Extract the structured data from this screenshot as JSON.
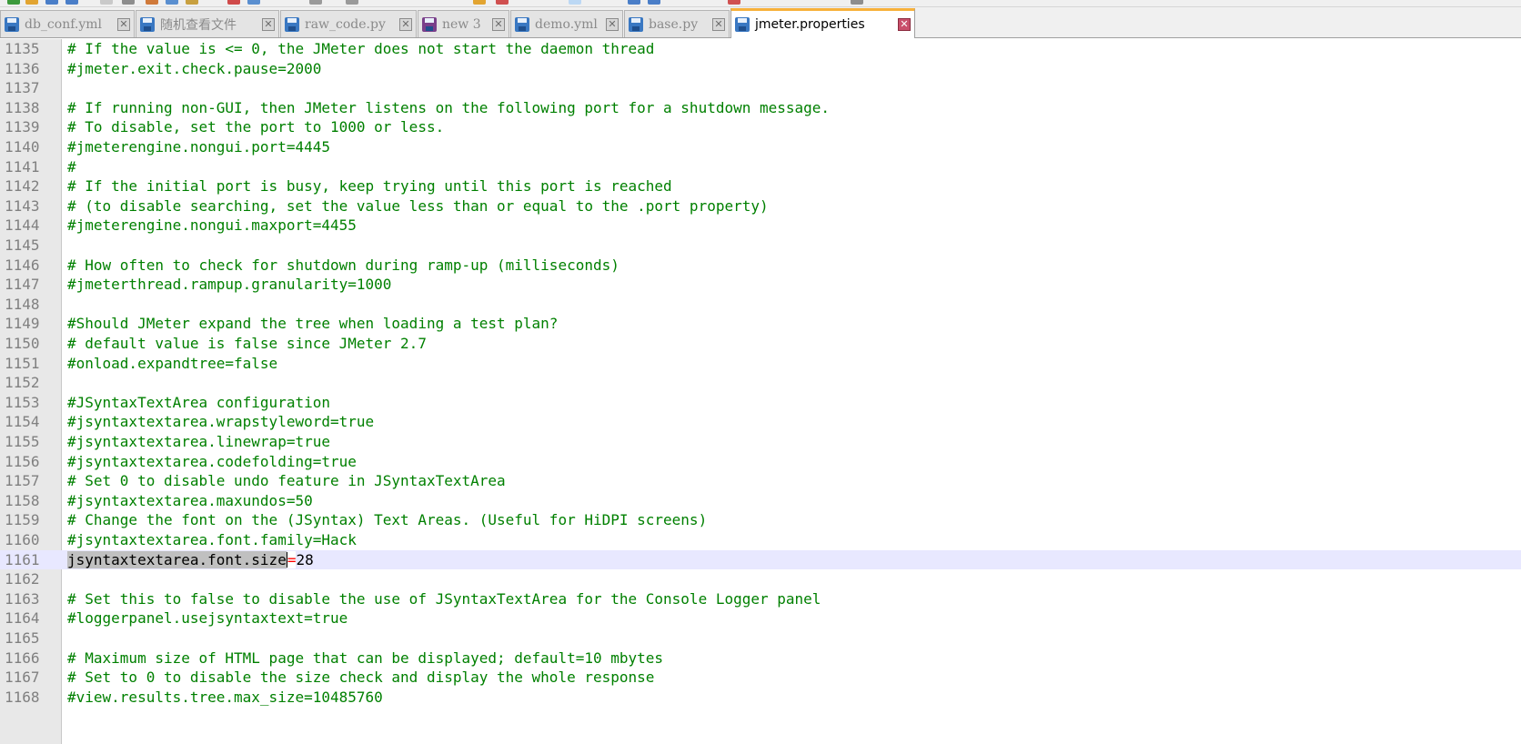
{
  "tabs": [
    {
      "label": "db_conf.yml",
      "active": false
    },
    {
      "label": "随机查看文件",
      "active": false
    },
    {
      "label": "raw_code.py",
      "active": false
    },
    {
      "label": "new 3",
      "active": false
    },
    {
      "label": "demo.yml",
      "active": false
    },
    {
      "label": "base.py",
      "active": false
    },
    {
      "label": "jmeter.properties",
      "active": true
    }
  ],
  "tab_close_glyph": "✕",
  "colors": {
    "comment": "#008000",
    "operator": "#ff0000",
    "current_line": "#e8e8ff",
    "active_tab_accent": "#f7b13b"
  },
  "editor": {
    "current_line": "1161",
    "lines": [
      {
        "n": "1135",
        "text": "# If the value is <= 0, the JMeter does not start the daemon thread"
      },
      {
        "n": "1136",
        "text": "#jmeter.exit.check.pause=2000"
      },
      {
        "n": "1137",
        "text": ""
      },
      {
        "n": "1138",
        "text": "# If running non-GUI, then JMeter listens on the following port for a shutdown message."
      },
      {
        "n": "1139",
        "text": "# To disable, set the port to 1000 or less."
      },
      {
        "n": "1140",
        "text": "#jmeterengine.nongui.port=4445"
      },
      {
        "n": "1141",
        "text": "#"
      },
      {
        "n": "1142",
        "text": "# If the initial port is busy, keep trying until this port is reached"
      },
      {
        "n": "1143",
        "text": "# (to disable searching, set the value less than or equal to the .port property)"
      },
      {
        "n": "1144",
        "text": "#jmeterengine.nongui.maxport=4455"
      },
      {
        "n": "1145",
        "text": ""
      },
      {
        "n": "1146",
        "text": "# How often to check for shutdown during ramp-up (milliseconds)"
      },
      {
        "n": "1147",
        "text": "#jmeterthread.rampup.granularity=1000"
      },
      {
        "n": "1148",
        "text": ""
      },
      {
        "n": "1149",
        "text": "#Should JMeter expand the tree when loading a test plan?"
      },
      {
        "n": "1150",
        "text": "# default value is false since JMeter 2.7"
      },
      {
        "n": "1151",
        "text": "#onload.expandtree=false"
      },
      {
        "n": "1152",
        "text": ""
      },
      {
        "n": "1153",
        "text": "#JSyntaxTextArea configuration"
      },
      {
        "n": "1154",
        "text": "#jsyntaxtextarea.wrapstyleword=true"
      },
      {
        "n": "1155",
        "text": "#jsyntaxtextarea.linewrap=true"
      },
      {
        "n": "1156",
        "text": "#jsyntaxtextarea.codefolding=true"
      },
      {
        "n": "1157",
        "text": "# Set 0 to disable undo feature in JSyntaxTextArea"
      },
      {
        "n": "1158",
        "text": "#jsyntaxtextarea.maxundos=50"
      },
      {
        "n": "1159",
        "text": "# Change the font on the (JSyntax) Text Areas. (Useful for HiDPI screens)"
      },
      {
        "n": "1160",
        "text": "#jsyntaxtextarea.font.family=Hack"
      },
      {
        "n": "1161",
        "key": "jsyntaxtextarea.font.size",
        "op": "=",
        "value": "28"
      },
      {
        "n": "1162",
        "text": ""
      },
      {
        "n": "1163",
        "text": "# Set this to false to disable the use of JSyntaxTextArea for the Console Logger panel"
      },
      {
        "n": "1164",
        "text": "#loggerpanel.usejsyntaxtext=true"
      },
      {
        "n": "1165",
        "text": ""
      },
      {
        "n": "1166",
        "text": "# Maximum size of HTML page that can be displayed; default=10 mbytes"
      },
      {
        "n": "1167",
        "text": "# Set to 0 to disable the size check and display the whole response"
      },
      {
        "n": "1168",
        "text": "#view.results.tree.max_size=10485760"
      }
    ]
  }
}
